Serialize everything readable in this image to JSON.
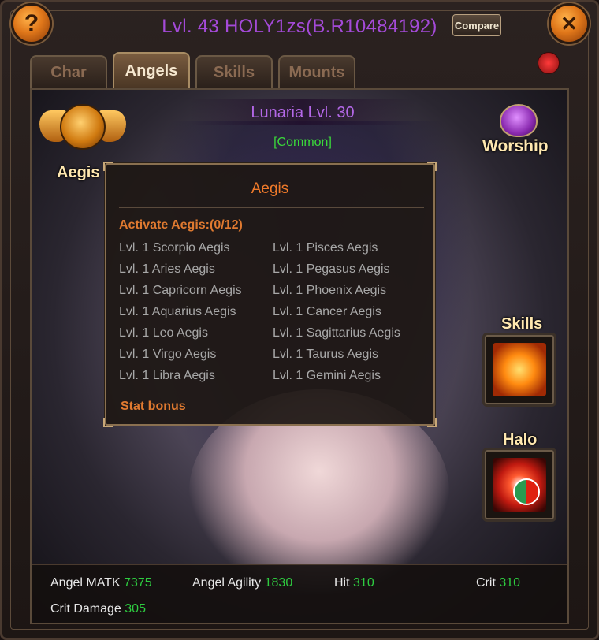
{
  "header": {
    "title": "Lvl. 43 HOLY1zs(B.R10484192)",
    "compare_label": "Compare",
    "help_icon": "?",
    "close_icon": "✕"
  },
  "tabs": [
    {
      "label": "Char",
      "active": false
    },
    {
      "label": "Angels",
      "active": true
    },
    {
      "label": "Skills",
      "active": false
    },
    {
      "label": "Mounts",
      "active": false
    }
  ],
  "angel": {
    "name": "Lunaria Lvl. 30",
    "rarity": "[Common]"
  },
  "emblems": {
    "aegis_label": "Aegis",
    "worship_label": "Worship",
    "skills_label": "Skills",
    "halo_label": "Halo"
  },
  "tooltip": {
    "title": "Aegis",
    "activate": "Activate Aegis:(0/12)",
    "items": [
      "Lvl. 1 Scorpio Aegis",
      "Lvl. 1 Pisces Aegis",
      "Lvl. 1 Aries Aegis",
      "Lvl. 1 Pegasus Aegis",
      "Lvl. 1 Capricorn Aegis",
      "Lvl. 1 Phoenix Aegis",
      "Lvl. 1 Aquarius Aegis",
      "Lvl. 1 Cancer Aegis",
      "Lvl. 1 Leo Aegis",
      "Lvl. 1 Sagittarius Aegis",
      "Lvl. 1 Virgo Aegis",
      "Lvl. 1 Taurus Aegis",
      "Lvl. 1 Libra Aegis",
      "Lvl. 1 Gemini Aegis"
    ],
    "stat_bonus": "Stat bonus"
  },
  "stats": {
    "matk_label": "Angel MATK",
    "matk_value": "7375",
    "agility_label": "Angel Agility",
    "agility_value": "1830",
    "hit_label": "Hit",
    "hit_value": "310",
    "crit_label": "Crit",
    "crit_value": "310",
    "critdmg_label": "Crit Damage",
    "critdmg_value": "305"
  },
  "colors": {
    "title": "#a44ad8",
    "angel_name": "#b468e8",
    "rarity": "#3ad83a",
    "tooltip_heading": "#f07a2a",
    "stat_value": "#2ecc40"
  },
  "icons": [
    "help-icon",
    "close-icon",
    "gift-icon",
    "aegis-emblem-icon",
    "worship-heart-icon",
    "skills-fire-icon",
    "halo-bagua-icon"
  ]
}
